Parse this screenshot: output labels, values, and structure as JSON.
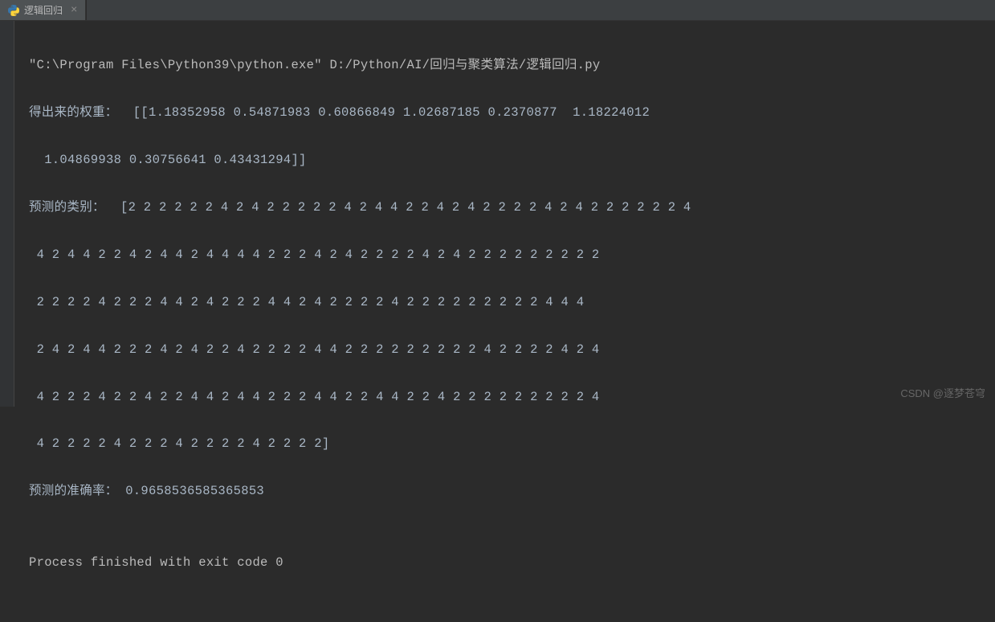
{
  "tab": {
    "label": "逻辑回归",
    "close": "×"
  },
  "console": {
    "command": "\"C:\\Program Files\\Python39\\python.exe\" D:/Python/AI/回归与聚类算法/逻辑回归.py",
    "weights_label": "得出来的权重：  [[1.18352958 0.54871983 0.60866849 1.02687185 0.2370877  1.18224012",
    "weights_cont": "  1.04869938 0.30756641 0.43431294]]",
    "pred_label": "预测的类别：  [2 2 2 2 2 2 4 2 4 2 2 2 2 2 4 2 4 4 2 2 4 2 4 2 2 2 2 4 2 4 2 2 2 2 2 2 4",
    "pred_l2": " 4 2 4 4 2 2 4 2 4 4 2 4 4 4 4 2 2 2 4 2 4 2 2 2 2 4 2 4 2 2 2 2 2 2 2 2 2",
    "pred_l3": " 2 2 2 2 4 2 2 2 4 4 2 4 2 2 2 4 4 2 4 2 2 2 2 4 2 2 2 2 2 2 2 2 2 4 4 4",
    "pred_l4": " 2 4 2 4 4 2 2 2 4 2 4 2 2 4 2 2 2 2 4 4 2 2 2 2 2 2 2 2 2 4 2 2 2 2 4 2 4",
    "pred_l5": " 4 2 2 2 4 2 2 4 2 2 4 4 2 4 4 2 2 2 4 4 2 2 4 4 2 2 4 2 2 2 2 2 2 2 2 2 4",
    "pred_l6": " 4 2 2 2 2 4 2 2 2 4 2 2 2 2 4 2 2 2 2]",
    "accuracy": "预测的准确率： 0.9658536585365853",
    "blank": "",
    "exit": "Process finished with exit code 0"
  },
  "watermark": "CSDN @逐梦苍穹"
}
